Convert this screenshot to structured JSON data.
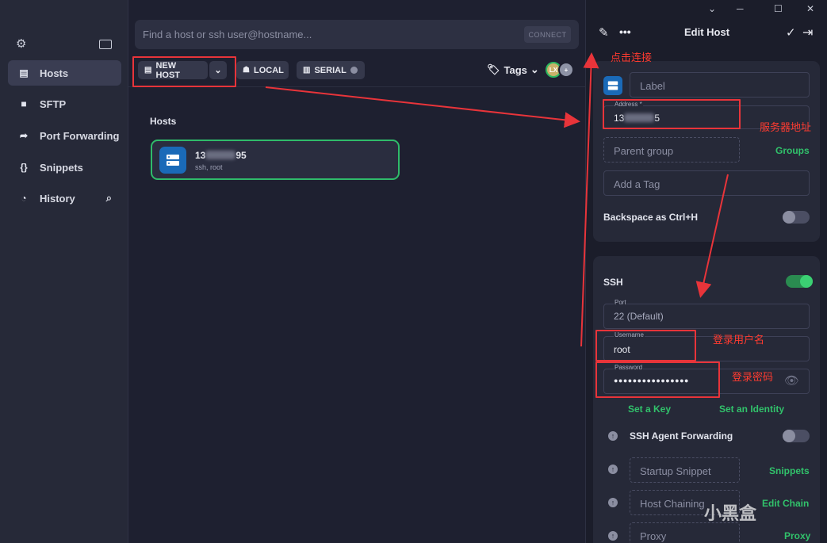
{
  "sidebar": {
    "items": [
      {
        "label": "Hosts",
        "icon": "server-icon"
      },
      {
        "label": "SFTP",
        "icon": "folder-icon"
      },
      {
        "label": "Port Forwarding",
        "icon": "arrow-forward-icon"
      },
      {
        "label": "Snippets",
        "icon": "braces-icon"
      },
      {
        "label": "History",
        "icon": "clock-icon"
      }
    ]
  },
  "main": {
    "search_placeholder": "Find a host or ssh user@hostname...",
    "connect_label": "CONNECT",
    "new_host_label": "NEW HOST",
    "local_label": "LOCAL",
    "serial_label": "SERIAL",
    "tags_label": "Tags",
    "avatar_initials": "LX",
    "hosts_heading": "Hosts",
    "host": {
      "name_start": "13",
      "name_end": "95",
      "sub": "ssh, root"
    }
  },
  "panel": {
    "title": "Edit Host",
    "label_placeholder": "Label",
    "address_label": "Address *",
    "address_start": "13",
    "address_end": "5",
    "parent_group_placeholder": "Parent group",
    "groups_link": "Groups",
    "tag_placeholder": "Add a Tag",
    "backspace_label": "Backspace as Ctrl+H",
    "ssh_label": "SSH",
    "port_label": "Port",
    "port_value": "22 (Default)",
    "username_label": "Username",
    "username_value": "root",
    "password_label": "Password",
    "password_value": "●●●●●●●●●●●●●●●●",
    "set_key": "Set a Key",
    "set_identity": "Set an Identity",
    "agent_forwarding": "SSH Agent Forwarding",
    "startup_snippet": "Startup Snippet",
    "snippets_link": "Snippets",
    "host_chaining": "Host Chaining",
    "edit_chain": "Edit Chain",
    "proxy_placeholder": "Proxy",
    "proxy_link": "Proxy"
  },
  "annotations": {
    "click_connect": "点击连接",
    "server_address": "服务器地址",
    "login_username": "登录用户名",
    "login_password": "登录密码"
  },
  "watermark": "小黑盒",
  "colors": {
    "accent_green": "#31c26b",
    "annotation_red": "#e8343a",
    "host_icon_blue": "#1a6ab8"
  }
}
